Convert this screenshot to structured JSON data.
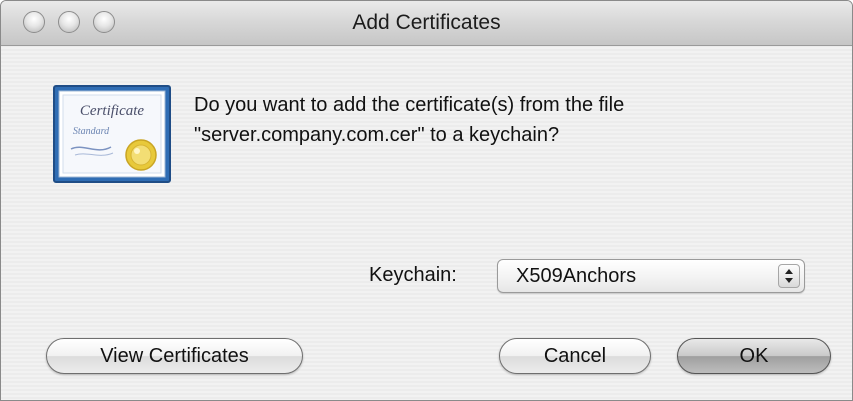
{
  "window": {
    "title": "Add Certificates"
  },
  "message": {
    "line1": "Do you want to add the certificate(s) from the file",
    "line2": "\"server.company.com.cer\" to a keychain?"
  },
  "icon": {
    "name": "certificate-icon",
    "text_top": "Certificate",
    "text_bottom": "Standard"
  },
  "keychain": {
    "label": "Keychain:",
    "selected": "X509Anchors"
  },
  "buttons": {
    "view_certificates": "View Certificates",
    "cancel": "Cancel",
    "ok": "OK"
  },
  "colors": {
    "seal_gold": "#e8c93a",
    "icon_frame": "#2f6db4"
  }
}
